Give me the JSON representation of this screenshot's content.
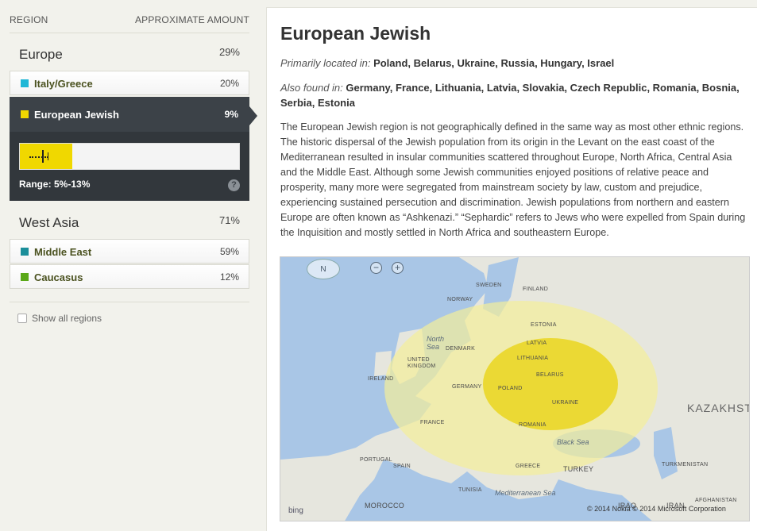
{
  "sidebar": {
    "header_region": "REGION",
    "header_amount": "APPROXIMATE AMOUNT",
    "groups": [
      {
        "name": "Europe",
        "percent": "29%"
      },
      {
        "name": "West Asia",
        "percent": "71%"
      }
    ],
    "rows": [
      {
        "label": "Italy/Greece",
        "percent": "20%",
        "color": "#1fb7d6"
      },
      {
        "label": "European Jewish",
        "percent": "9%",
        "color": "#f0d800"
      },
      {
        "label": "Middle East",
        "percent": "59%",
        "color": "#1b8e9a"
      },
      {
        "label": "Caucasus",
        "percent": "12%",
        "color": "#5aa818"
      }
    ],
    "range_text": "Range: 5%-13%",
    "range": {
      "low": 5,
      "high": 13,
      "estimate": 9
    },
    "help_icon": "?",
    "show_all": "Show all regions"
  },
  "detail": {
    "title": "European Jewish",
    "primarily_label": "Primarily located in:",
    "primarily_value": "Poland, Belarus, Ukraine, Russia, Hungary, Israel",
    "also_label": "Also found in:",
    "also_value": "Germany, France, Lithuania, Latvia, Slovakia, Czech Republic, Romania, Bosnia, Serbia, Estonia",
    "description": "The European Jewish region is not geographically defined in the same way as most other ethnic regions. The historic dispersal of the Jewish population from its origin in the Levant on the east coast of the Mediterranean resulted in insular communities scattered throughout Europe, North Africa, Central Asia and the Middle East. Although some Jewish communities enjoyed positions of relative peace and prosperity, many more were segregated from mainstream society by law, custom and prejudice, experiencing sustained persecution and discrimination. Jewish populations from northern and eastern Europe are often known as “Ashkenazi.” “Sephardic” refers to Jews who were expelled from Spain during the Inquisition and mostly settled in North Africa and southeastern Europe."
  },
  "map": {
    "compass": "N",
    "zoom_out": "−",
    "zoom_in": "+",
    "bing": "bing",
    "copyright": "© 2014 Nokia   © 2014 Microsoft Corporation",
    "labels": {
      "sweden": "SWEDEN",
      "finland": "FINLAND",
      "norway": "NORWAY",
      "estonia": "ESTONIA",
      "latvia": "LATVIA",
      "lithuania": "LITHUANIA",
      "denmark": "DENMARK",
      "uk": "UNITED\nKINGDOM",
      "ireland": "IRELAND",
      "belarus": "BELARUS",
      "poland": "POLAND",
      "germany": "GERMANY",
      "ukraine": "UKRAINE",
      "france": "FRANCE",
      "romania": "ROMANIA",
      "portugal": "PORTUGAL",
      "spain": "SPAIN",
      "greece": "GREECE",
      "turkey": "TURKEY",
      "turkmenistan": "TURKMENISTAN",
      "morocco": "MOROCCO",
      "tunisia": "TUNISIA",
      "iraq": "IRAQ",
      "iran": "IRAN",
      "afghanistan": "AFGHANISTAN",
      "kazakhstan": "KAZAKHST"
    },
    "seas": {
      "north": "North\nSea",
      "black": "Black Sea",
      "med": "Mediterranean Sea"
    },
    "colors": {
      "inner": "#e8d200",
      "outer": "#f4ee9a"
    }
  }
}
